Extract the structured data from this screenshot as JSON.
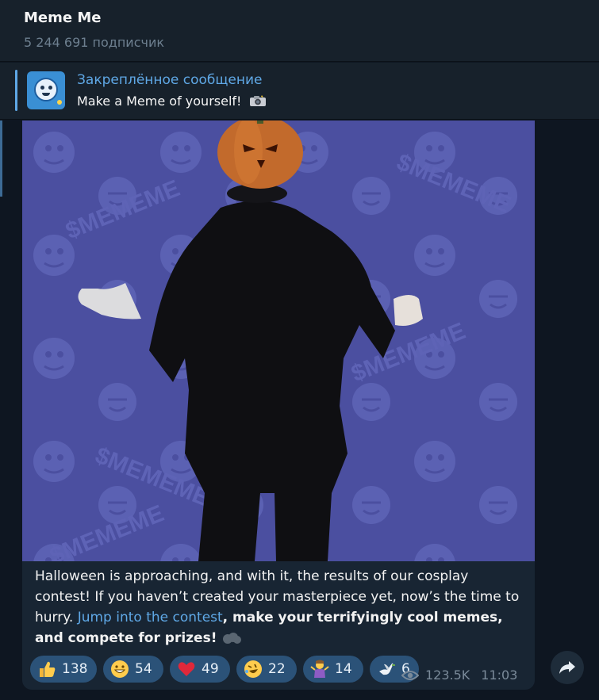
{
  "channel": {
    "title": "Meme Me",
    "subscribers": "5 244 691 подписчик"
  },
  "pinned": {
    "label": "Закреплённое сообщение",
    "text": "Make a Meme of yourself!",
    "emoji_icon": "camera-flash-icon"
  },
  "media": {
    "watermark": "$MEMEME",
    "description_icon": "pumpkin-head-dancer"
  },
  "post": {
    "caption_part1": "Halloween is approaching, and with it, the results of our cosplay contest! If you haven’t created your masterpiece yet, now’s the time to hurry. ",
    "link_text": "Jump into the contest",
    "caption_bold": ", make your terrifyingly cool memes, and compete for prizes!",
    "trailing_emoji": "thought-bubble-icon"
  },
  "reactions": [
    {
      "emoji": "thumbs-up-icon",
      "count": "138"
    },
    {
      "emoji": "grinning-face-icon",
      "count": "54"
    },
    {
      "emoji": "red-heart-icon",
      "count": "49"
    },
    {
      "emoji": "rofl-face-icon",
      "count": "22"
    },
    {
      "emoji": "person-shrugging-icon",
      "count": "14"
    },
    {
      "emoji": "dove-icon",
      "count": "6"
    }
  ],
  "meta": {
    "views": "123.5K",
    "time": "11:03"
  },
  "colors": {
    "background": "#0e1621",
    "panel": "#17212b",
    "bubble": "#182533",
    "accent": "#5fa8e6",
    "reaction_bg": "#2b5278",
    "media_bg": "#4b4fa0"
  }
}
